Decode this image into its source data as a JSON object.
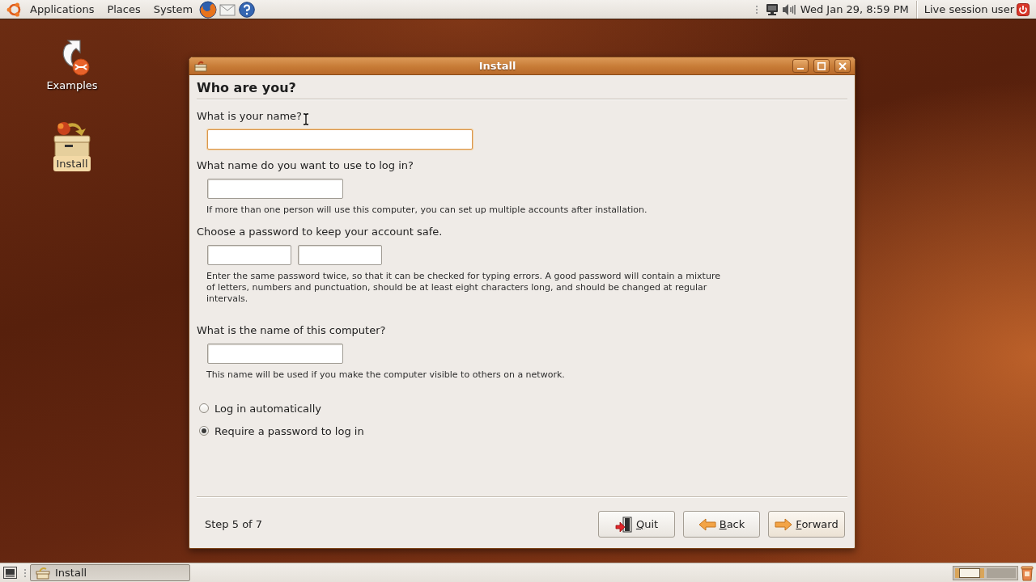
{
  "top_panel": {
    "menus": [
      "Applications",
      "Places",
      "System"
    ],
    "clock": "Wed Jan 29, 8:59 PM",
    "user": "Live session user"
  },
  "desktop_icons": [
    {
      "label": "Examples",
      "kind": "link",
      "selected": false
    },
    {
      "label": "Install",
      "kind": "installer",
      "selected": true
    }
  ],
  "window": {
    "title": "Install",
    "heading": "Who are you?",
    "sections": [
      {
        "kind": "name",
        "label": "What is your name?",
        "mouse_cursor": true,
        "inputs": [
          {
            "focused": true
          }
        ]
      },
      {
        "kind": "login",
        "label": "What name do you want to use to log in?",
        "inputs": [
          {
            "focused": false
          }
        ],
        "hint": "If more than one person will use this computer, you can set up multiple accounts after installation."
      },
      {
        "kind": "password",
        "label": "Choose a password to keep your account safe.",
        "inputs": [
          {
            "focused": false
          },
          {
            "focused": false
          }
        ],
        "hint": "Enter the same password twice, so that it can be checked for typing errors. A good password will contain a mixture of letters, numbers and punctuation, should be at least eight characters long, and should be changed at regular intervals."
      },
      {
        "kind": "computer",
        "label": "What is the name of this computer?",
        "inputs": [
          {
            "focused": false
          }
        ],
        "hint": "This name will be used if you make the computer visible to others on a network."
      }
    ],
    "login_options": [
      {
        "label": "Log in automatically",
        "selected": false
      },
      {
        "label": "Require a password to log in",
        "selected": true
      }
    ],
    "step": "Step 5 of 7",
    "buttons": [
      {
        "label": "Quit",
        "kind": "quit"
      },
      {
        "label": "Back",
        "kind": "back"
      },
      {
        "label": "Forward",
        "kind": "forward"
      }
    ]
  },
  "bottom_panel": {
    "tasks": [
      {
        "label": "Install",
        "selected": true
      }
    ],
    "workspaces": [
      {
        "selected": true
      },
      {
        "selected": false
      }
    ]
  }
}
